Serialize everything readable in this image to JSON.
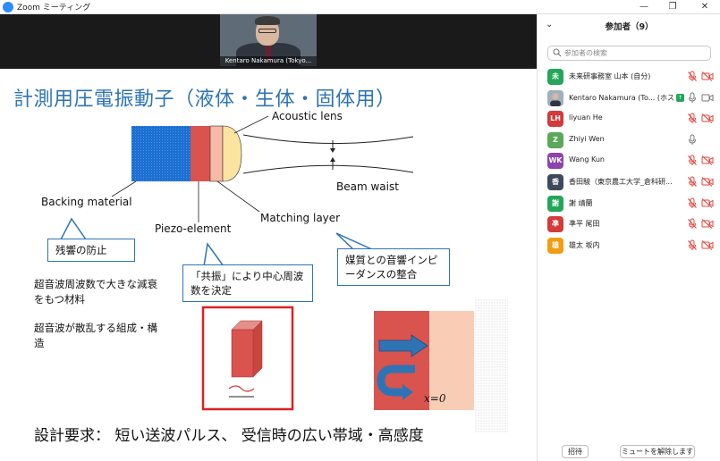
{
  "window": {
    "title": "Zoom ミーティング",
    "minimize": "—",
    "restore": "❐",
    "close": "✕"
  },
  "video": {
    "name": "Kentaro Nakamura (Tokyo..."
  },
  "slide": {
    "title": "計測用圧電振動子（液体・生体・固体用）",
    "labels": {
      "acoustic_lens": "Acoustic lens",
      "beam_waist": "Beam waist",
      "backing_material": "Backing material",
      "piezo_element": "Piezo-element",
      "matching_layer": "Matching layer",
      "x_zero": "x=0"
    },
    "callouts": {
      "backing": "残響の防止",
      "piezo": "「共振」により中心周波数を決定",
      "matching": "媒質との音響インピーダンスの整合"
    },
    "notes": {
      "note1": "超音波周波数で大きな減衰をもつ材料",
      "note2": "超音波が散乱する組成・構造"
    },
    "design_requirement": "設計要求：  短い送波パルス、  受信時の広い帯域・高感度"
  },
  "panel": {
    "title": "参加者（9）",
    "chevron": "⌄",
    "search_placeholder": "参加者の検索",
    "invite": "招待",
    "unmute_all": "ミュートを解除します"
  },
  "participants": [
    {
      "avatar": "未",
      "name": "未来研事務室 山本 (自分)",
      "color": "#23a65a",
      "mic_muted": true,
      "cam_off": true
    },
    {
      "avatar": "",
      "name": "Kentaro Nakamura (To... (ホスト)",
      "color": "#c7cfd6",
      "mic_muted": false,
      "cam_off": false,
      "photo": true,
      "sharing": true
    },
    {
      "avatar": "LH",
      "name": "liyuan He",
      "color": "#d33a3a",
      "mic_muted": true,
      "cam_off": true
    },
    {
      "avatar": "Z",
      "name": "Zhiyi Wen",
      "color": "#5ba85a",
      "mic_muted": false,
      "cam_off": false,
      "mic_only": true
    },
    {
      "avatar": "WK",
      "name": "Wang Kun",
      "color": "#8e44ad",
      "mic_muted": true,
      "cam_off": true
    },
    {
      "avatar": "香",
      "name": "香田駿（東京農工大学_倉科研...",
      "color": "#3d4a5c",
      "mic_muted": true,
      "cam_off": true
    },
    {
      "avatar": "謝",
      "name": "謝 靖蘭",
      "color": "#23a65a",
      "mic_muted": true,
      "cam_off": true
    },
    {
      "avatar": "凖",
      "name": "凖平 尾田",
      "color": "#d33a3a",
      "mic_muted": true,
      "cam_off": true
    },
    {
      "avatar": "雄",
      "name": "雄太 坂内",
      "color": "#f39c12",
      "mic_muted": true,
      "cam_off": true
    }
  ]
}
